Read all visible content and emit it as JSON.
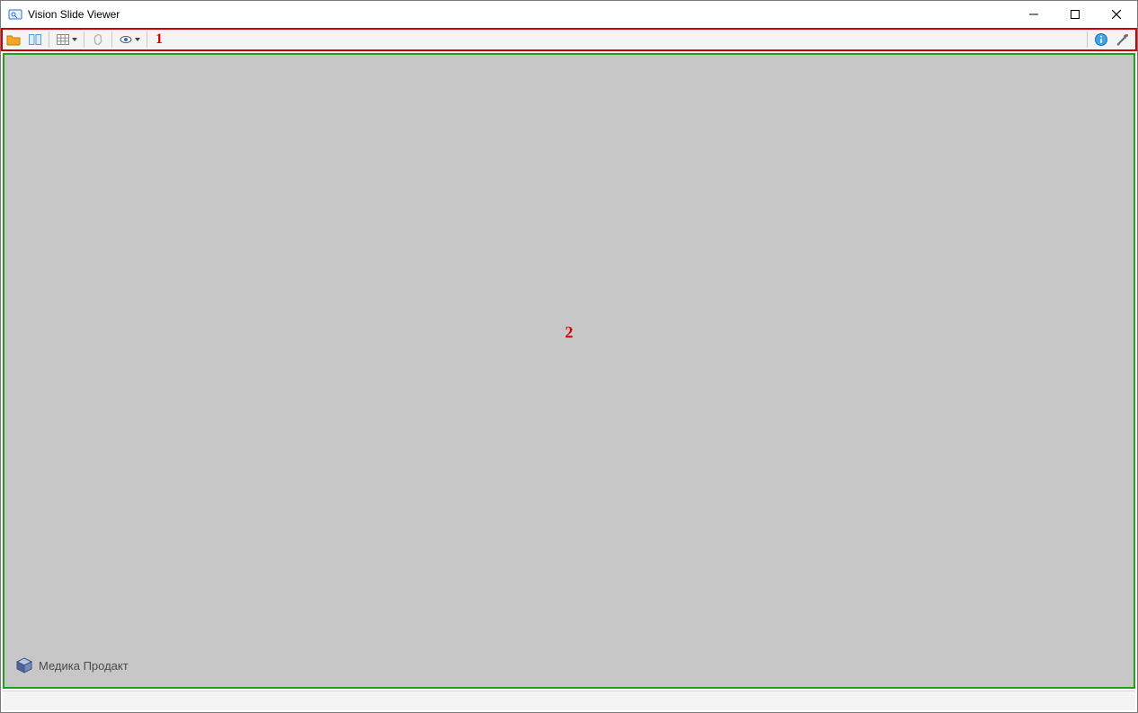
{
  "window": {
    "title": "Vision Slide Viewer"
  },
  "toolbar": {
    "icons": {
      "open": "open-folder-icon",
      "compare": "compare-panes-icon",
      "grid": "grid-icon",
      "link": "link-icon",
      "view": "eye-icon",
      "info": "info-icon",
      "tools": "tools-icon"
    }
  },
  "annotations": {
    "toolbar_label": "1",
    "viewport_label": "2"
  },
  "watermark": {
    "text": "Медика Продакт"
  },
  "colors": {
    "toolbar_highlight": "#d40000",
    "viewport_highlight": "#18a618"
  }
}
